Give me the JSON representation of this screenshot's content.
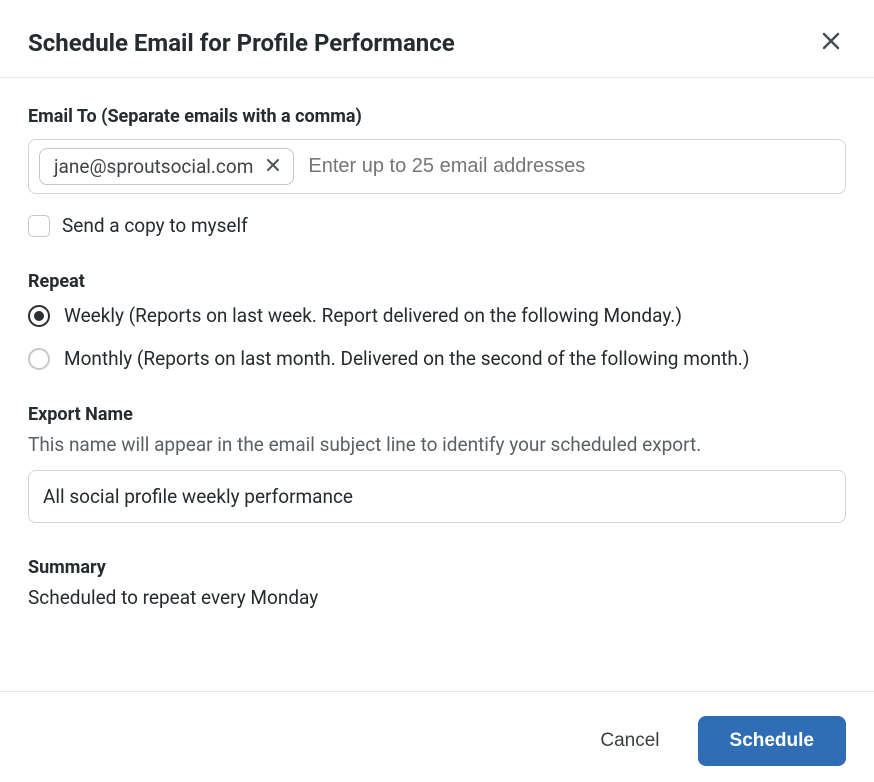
{
  "header": {
    "title": "Schedule Email for Profile Performance"
  },
  "emailTo": {
    "label": "Email To (Separate emails with a comma)",
    "chips": [
      "jane@sproutsocial.com"
    ],
    "placeholder": "Enter up to 25 email addresses"
  },
  "sendCopy": {
    "label": "Send a copy to myself",
    "checked": false
  },
  "repeat": {
    "label": "Repeat",
    "options": [
      {
        "label": "Weekly (Reports on last week. Report delivered on the following Monday.)",
        "selected": true
      },
      {
        "label": "Monthly (Reports on last month. Delivered on the second of the following month.)",
        "selected": false
      }
    ]
  },
  "exportName": {
    "label": "Export Name",
    "helper": "This name will appear in the email subject line to identify your scheduled export.",
    "value": "All social profile weekly performance"
  },
  "summary": {
    "label": "Summary",
    "text": "Scheduled to repeat every Monday"
  },
  "footer": {
    "cancel": "Cancel",
    "schedule": "Schedule"
  }
}
